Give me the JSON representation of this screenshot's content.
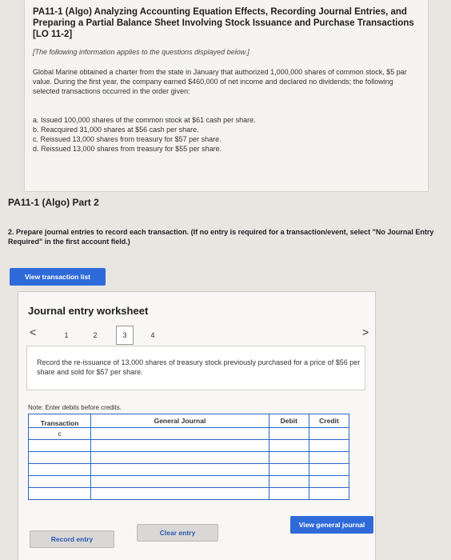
{
  "problem": {
    "title": "PA11-1 (Algo) Analyzing Accounting Equation Effects, Recording Journal Entries, and Preparing a Partial Balance Sheet Involving Stock Issuance and Purchase Transactions [LO 11-2]",
    "note": "[The following information applies to the questions displayed below.]",
    "text": "Global Marine obtained a charter from the state in January that authorized 1,000,000 shares of common stock, $5 par value. During the first year, the company earned $460,000 of net income and declared no dividends; the following selected transactions occurred in the order given:",
    "transactions": [
      "a. Issued 100,000 shares of the common stock at $61 cash per share.",
      "b. Reacquired 31,000 shares at $56 cash per share.",
      "c. Reissued 13,000 shares from treasury for $57 per share.",
      "d. Reissued 13,000 shares from treasury for $55 per share."
    ]
  },
  "part_title": "PA11-1 (Algo) Part 2",
  "instructions": {
    "main": "2. Prepare journal entries to record each transaction. ",
    "bold": "(If no entry is required for a transaction/event, select \"No Journal Entry Required\" in the first account field.)"
  },
  "view_list_label": "View transaction list",
  "worksheet": {
    "title": "Journal entry worksheet",
    "tabs": [
      "1",
      "2",
      "3",
      "4"
    ],
    "active_tab": "3",
    "left_arrow": "<",
    "right_arrow": ">",
    "description": "Record the re-issuance of 13,000 shares of treasury stock previously purchased for a price of $56 per share and sold for $57 per share.",
    "note": "Note: Enter debits before credits.",
    "columns": {
      "transaction": "Transaction",
      "general_journal": "General Journal",
      "debit": "Debit",
      "credit": "Credit"
    },
    "rows": [
      {
        "transaction": "c",
        "account": "",
        "debit": "",
        "credit": ""
      },
      {
        "transaction": "",
        "account": "",
        "debit": "",
        "credit": ""
      },
      {
        "transaction": "",
        "account": "",
        "debit": "",
        "credit": ""
      },
      {
        "transaction": "",
        "account": "",
        "debit": "",
        "credit": ""
      },
      {
        "transaction": "",
        "account": "",
        "debit": "",
        "credit": ""
      },
      {
        "transaction": "",
        "account": "",
        "debit": "",
        "credit": ""
      }
    ],
    "buttons": {
      "record": "Record entry",
      "clear": "Clear entry",
      "view_general": "View general journal"
    }
  }
}
